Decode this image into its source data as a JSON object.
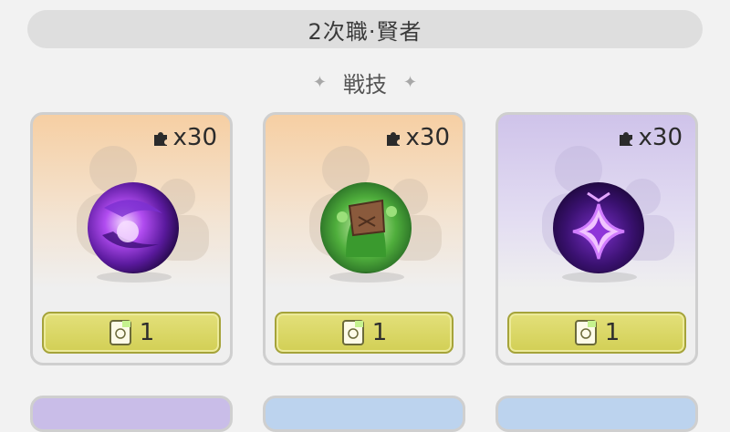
{
  "header": {
    "title": "2次職·賢者"
  },
  "section": {
    "title": "戦技"
  },
  "cards": [
    {
      "cost_label": "x30",
      "price": "1",
      "theme": "orange",
      "icon": "purple-orb-skill-icon"
    },
    {
      "cost_label": "x30",
      "price": "1",
      "theme": "orange",
      "icon": "tree-stump-creature-skill-icon"
    },
    {
      "cost_label": "x30",
      "price": "1",
      "theme": "purple",
      "icon": "purple-diamond-rune-skill-icon"
    }
  ],
  "colors": {
    "button_fill": "#d8d55e",
    "orange_card_top": "#f6cfa3",
    "purple_card_top": "#cfc3ea"
  }
}
